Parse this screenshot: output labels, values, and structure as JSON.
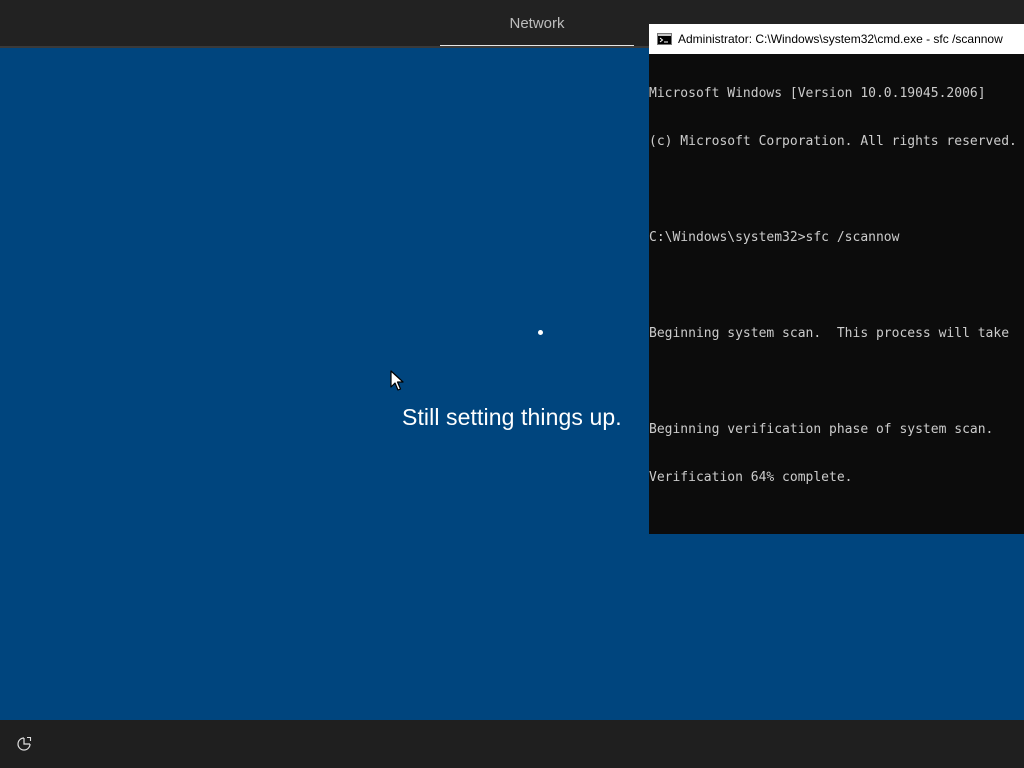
{
  "header": {
    "tab_label": "Network"
  },
  "setup": {
    "status_text": "Still setting things up."
  },
  "cmd": {
    "title": "Administrator: C:\\Windows\\system32\\cmd.exe - sfc  /scannow",
    "lines": [
      "Microsoft Windows [Version 10.0.19045.2006]",
      "(c) Microsoft Corporation. All rights reserved.",
      "",
      "C:\\Windows\\system32>sfc /scannow",
      "",
      "Beginning system scan.  This process will take",
      "",
      "Beginning verification phase of system scan.",
      "Verification 64% complete."
    ]
  },
  "footer": {
    "accessibility_icon": "accessibility-icon"
  },
  "colors": {
    "background": "#00457e",
    "topbar": "#222222",
    "bottombar": "#1f1f1f",
    "console_bg": "#0c0c0c",
    "console_text": "#cccccc"
  }
}
